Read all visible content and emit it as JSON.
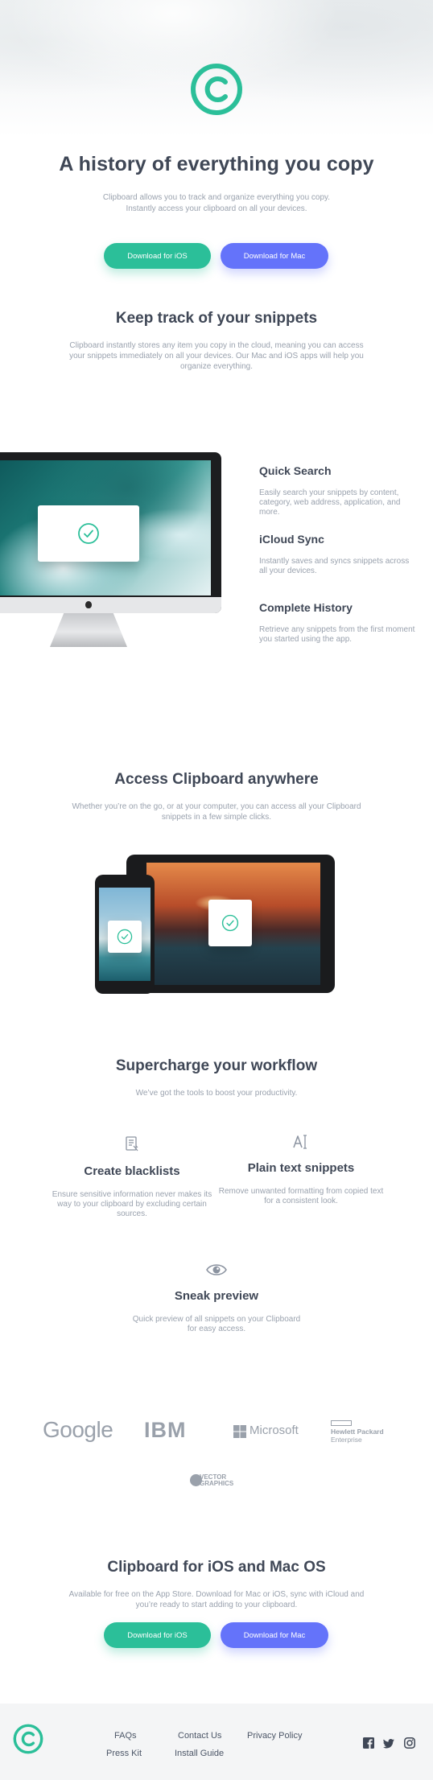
{
  "hero": {
    "title": "A history of everything you copy",
    "description_line1": "Clipboard allows you to track and organize everything you copy.",
    "description_line2": "Instantly access your clipboard on all your devices.",
    "ios_button": "Download for iOS",
    "mac_button": "Download for Mac"
  },
  "snippets": {
    "title": "Keep track of your snippets",
    "line1": "Clipboard instantly stores any item you copy in the cloud, meaning you can access",
    "line2": "your snippets immediately on all your devices. Our Mac and iOS apps will help you",
    "line3": "organize everything."
  },
  "features": [
    {
      "title": "Quick Search",
      "line1": "Easily search your snippets by content,",
      "line2": "category, web address, application, and",
      "line3": "more."
    },
    {
      "title": "iCloud Sync",
      "line1": "Instantly saves and syncs snippets across",
      "line2": "all your devices."
    },
    {
      "title": "Complete History",
      "line1": "Retrieve any snippets from the first moment",
      "line2": "you started using the app."
    }
  ],
  "access": {
    "title": "Access Clipboard anywhere",
    "line1": "Whether you’re on the go, or at your computer, you can access all your Clipboard",
    "line2": "snippets in a few simple clicks."
  },
  "workflow": {
    "title": "Supercharge your workflow",
    "subtitle": "We’ve got the tools to boost your productivity.",
    "items": [
      {
        "icon": "blacklist-icon",
        "title": "Create blacklists",
        "line1": "Ensure sensitive information never makes its",
        "line2": "way to your clipboard by excluding certain",
        "line3": "sources."
      },
      {
        "icon": "text-icon",
        "title": "Plain text snippets",
        "line1": "Remove unwanted formatting from copied text",
        "line2": "for a consistent look."
      },
      {
        "icon": "eye-icon",
        "title": "Sneak preview",
        "line1": "Quick preview of all snippets on your Clipboard",
        "line2": "for easy access."
      }
    ]
  },
  "brands": {
    "google": "Google",
    "ibm": "IBM",
    "microsoft": "Microsoft",
    "hp_line1": "Hewlett Packard",
    "hp_line2": "Enterprise",
    "vector_line1": "VECTOR",
    "vector_line2": "GRAPHICS"
  },
  "cta": {
    "title": "Clipboard for iOS and Mac OS",
    "line1": "Available for free on the App Store. Download for Mac or iOS, sync with iCloud and",
    "line2": "you’re ready to start adding to your clipboard.",
    "ios_button": "Download for iOS",
    "mac_button": "Download for Mac"
  },
  "footer": {
    "links": [
      "FAQs",
      "Contact Us",
      "Privacy Policy",
      "Press Kit",
      "Install Guide"
    ],
    "social": [
      "facebook-icon",
      "twitter-icon",
      "instagram-icon"
    ]
  },
  "colors": {
    "teal": "#2bbf99",
    "blue": "#6473fa",
    "heading": "#3f4756",
    "body": "#9aa2ae"
  }
}
